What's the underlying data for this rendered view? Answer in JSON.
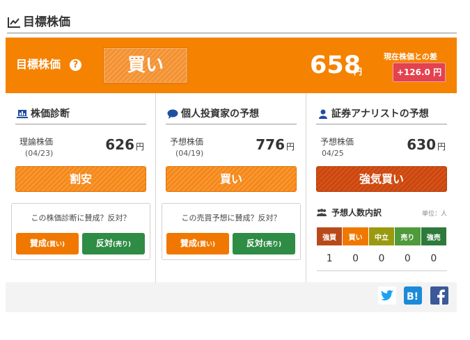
{
  "section": {
    "title": "目標株価"
  },
  "banner": {
    "label": "目標株価",
    "help": "?",
    "rating": "買い",
    "price": "658",
    "price_unit": "円",
    "diff_label": "現在株価との差",
    "diff": "+126.0 円"
  },
  "diagnosis": {
    "title": "株価診断",
    "price_label": "理論株価",
    "date": "(04/23)",
    "price": "626",
    "unit": "円",
    "judge": "割安",
    "vote_question": "この株価診断に賛成？反対？",
    "agree_label": "賛成",
    "agree_sub": "(買い)",
    "disagree_label": "反対",
    "disagree_sub": "(売り)"
  },
  "individual": {
    "title": "個人投資家の予想",
    "price_label": "予想株価",
    "date": "(04/19)",
    "price": "776",
    "unit": "円",
    "judge": "買い",
    "vote_question": "この売買予想に賛成？反対？",
    "agree_label": "賛成",
    "agree_sub": "(買い)",
    "disagree_label": "反対",
    "disagree_sub": "(売り)"
  },
  "analyst": {
    "title": "証券アナリストの予想",
    "price_label": "予想株価",
    "date": "04/25",
    "price": "630",
    "unit": "円",
    "judge": "強気買い",
    "breakdown_title": "予想人数内訳",
    "breakdown_unit": "単位：人",
    "headers": [
      "強買",
      "買い",
      "中立",
      "売り",
      "強売"
    ],
    "header_colors": [
      "#b84a1a",
      "#f07800",
      "#9a9a10",
      "#4f9a3a",
      "#2e7a3a"
    ],
    "counts": [
      "1",
      "0",
      "0",
      "0",
      "0"
    ]
  },
  "share": {
    "twitter": "twitter-icon",
    "hatena": "hatena-icon",
    "facebook": "facebook-icon"
  },
  "colors": {
    "accent": "#f58200",
    "diff_badge": "#e3424f",
    "buy": "#f07800",
    "sell": "#2e8c45"
  }
}
